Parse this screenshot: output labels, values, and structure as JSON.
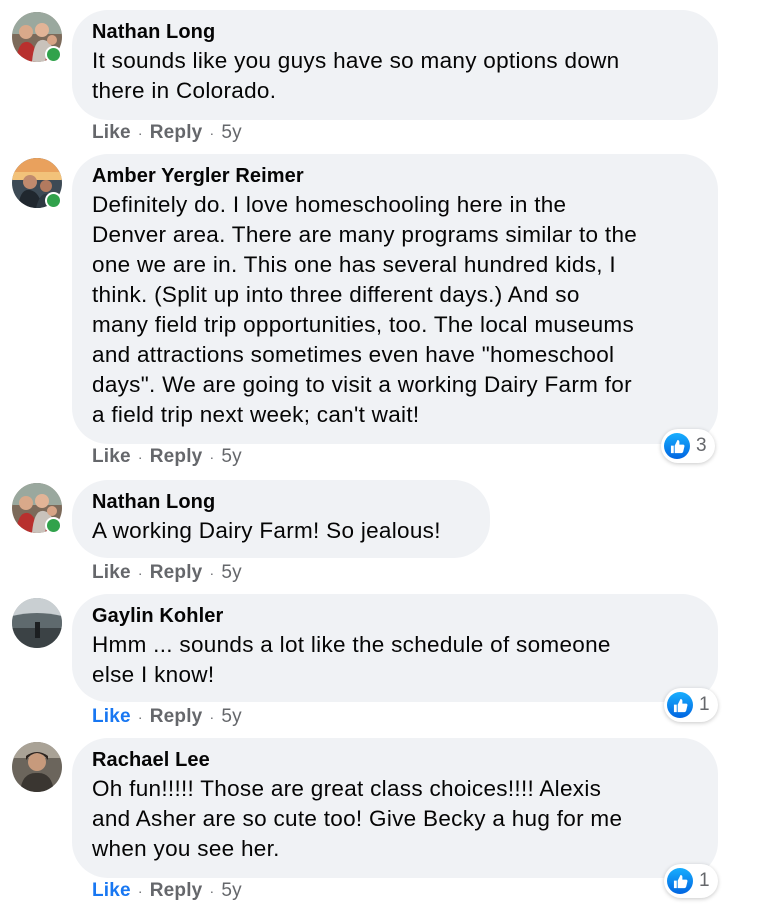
{
  "comments": [
    {
      "author": "Nathan Long",
      "text": "It sounds like you guys have so many options down\nthere in Colorado.",
      "like_label": "Like",
      "reply_label": "Reply",
      "time": "5y"
    },
    {
      "author": "Amber Yergler Reimer",
      "text": "Definitely do. I love homeschooling here in the\nDenver area. There are many programs similar to the\none we are in. This one has several hundred kids, I\nthink. (Split up into three different days.) And so\nmany field trip opportunities, too. The local museums\nand attractions sometimes even have \"homeschool\ndays\". We are going to visit a working Dairy Farm for\na field trip next week; can't wait!",
      "like_label": "Like",
      "reply_label": "Reply",
      "time": "5y",
      "reaction_count": "3"
    },
    {
      "author": "Nathan Long",
      "text": "A working Dairy Farm! So jealous!",
      "like_label": "Like",
      "reply_label": "Reply",
      "time": "5y"
    },
    {
      "author": "Gaylin Kohler",
      "text": "Hmm ... sounds a lot like the schedule of someone\nelse I know!",
      "like_label": "Like",
      "reply_label": "Reply",
      "time": "5y",
      "reaction_count": "1",
      "liked": true
    },
    {
      "author": "Rachael Lee",
      "text": "Oh fun!!!!! Those are great class choices!!!! Alexis\nand Asher are so cute too! Give Becky a hug for me\nwhen you see her.",
      "like_label": "Like",
      "reply_label": "Reply",
      "time": "5y",
      "reaction_count": "1",
      "liked": true
    }
  ],
  "separator": "·",
  "colors": {
    "bubble": "#f0f2f5",
    "meta_text": "#65676b",
    "liked_blue": "#1877f2",
    "online_green": "#31a24c"
  }
}
